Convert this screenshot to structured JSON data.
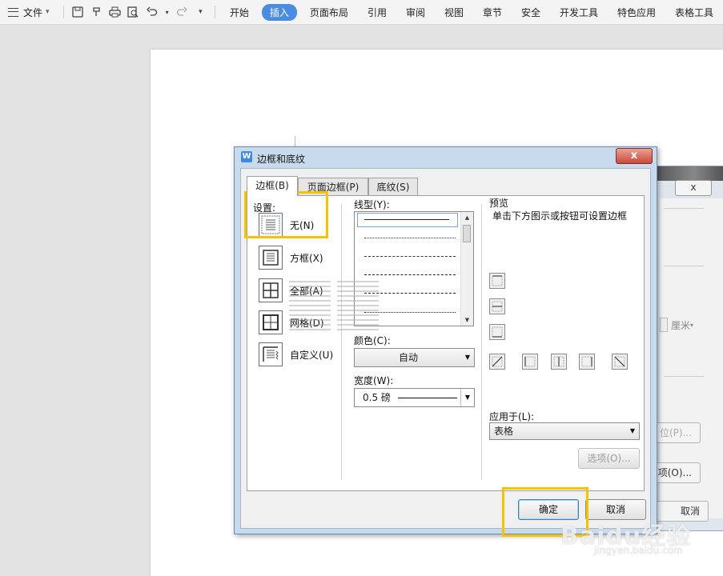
{
  "toolbar": {
    "file_label": "文件",
    "menus": [
      "开始",
      "插入",
      "页面布局",
      "引用",
      "审阅",
      "视图",
      "章节",
      "安全",
      "开发工具",
      "特色应用",
      "表格工具"
    ],
    "active_menu": "插入",
    "accent_color": "#4a8de0"
  },
  "dialog": {
    "title": "边框和底纹",
    "logo": "W",
    "close_symbol": "x",
    "tabs": [
      "边框(B)",
      "页面边框(P)",
      "底纹(S)"
    ],
    "settings_label": "设置:",
    "settings": [
      "无(N)",
      "方框(X)",
      "全部(A)",
      "网格(D)",
      "自定义(U)"
    ],
    "line_style_label": "线型(Y):",
    "color_label": "颜色(C):",
    "color_value": "自动",
    "width_label": "宽度(W):",
    "width_value": "0.5 磅",
    "preview_label": "预览",
    "preview_hint": "单击下方图示或按钮可设置边框",
    "apply_to_label": "应用于(L):",
    "apply_to_value": "表格",
    "options_button": "选项(O)...",
    "ok_button": "确定",
    "cancel_button": "取消",
    "highlight_color": "#f5c400"
  },
  "background_dialog": {
    "close_symbol": "x",
    "unit": "厘米",
    "btn_position": "位(P)...",
    "btn_options": "项(O)...",
    "btn_cancel": "取消"
  },
  "watermark": {
    "brand": "Baidu经验",
    "url": "jingyan.baidu.com"
  }
}
